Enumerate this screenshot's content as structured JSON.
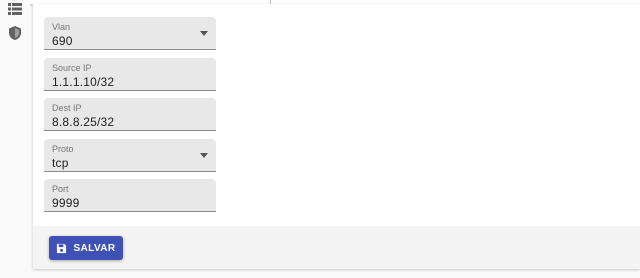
{
  "sidebar": {
    "icons": [
      "list-icon",
      "shield-icon"
    ]
  },
  "form": {
    "fields": [
      {
        "label": "Vlan",
        "value": "690",
        "type": "select"
      },
      {
        "label": "Source IP",
        "value": "1.1.1.10/32",
        "type": "text"
      },
      {
        "label": "Dest IP",
        "value": "8.8.8.25/32",
        "type": "text"
      },
      {
        "label": "Proto",
        "value": "tcp",
        "type": "select"
      },
      {
        "label": "Port",
        "value": "9999",
        "type": "text"
      }
    ]
  },
  "actions": {
    "save_label": "SALVAR"
  },
  "colors": {
    "primary": "#3f51b5",
    "field_bg": "#e8e8e8",
    "page_bg": "#fafafa"
  }
}
